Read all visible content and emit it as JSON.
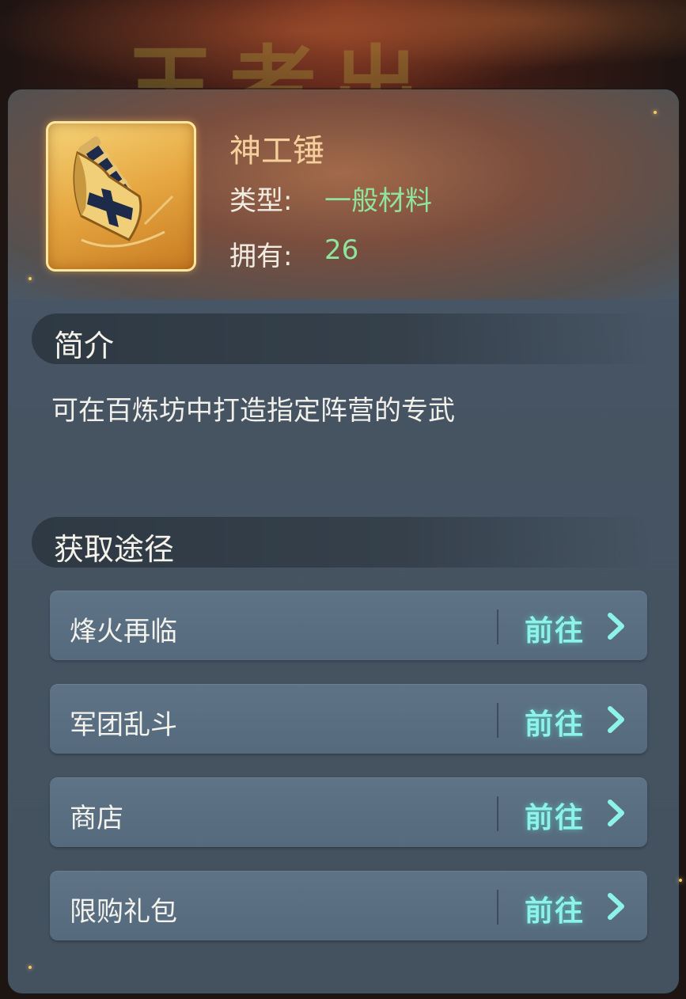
{
  "background": {
    "glyphs": "王者出…"
  },
  "item": {
    "name": "神工锤",
    "type_label": "类型:",
    "type_value": "一般材料",
    "owned_label": "拥有:",
    "owned_value": "26",
    "icon": "hammer-icon"
  },
  "intro": {
    "title": "简介",
    "description": "可在百炼坊中打造指定阵营的专武"
  },
  "sources": {
    "title": "获取途径",
    "items": [
      {
        "name": "烽火再临",
        "action": "前往"
      },
      {
        "name": "军团乱斗",
        "action": "前往"
      },
      {
        "name": "商店",
        "action": "前往"
      },
      {
        "name": "限购礼包",
        "action": "前往"
      }
    ]
  },
  "colors": {
    "accent_green": "#8fe39c",
    "goto_cyan": "#8df2e8",
    "name_gold": "#f5cf9c"
  }
}
